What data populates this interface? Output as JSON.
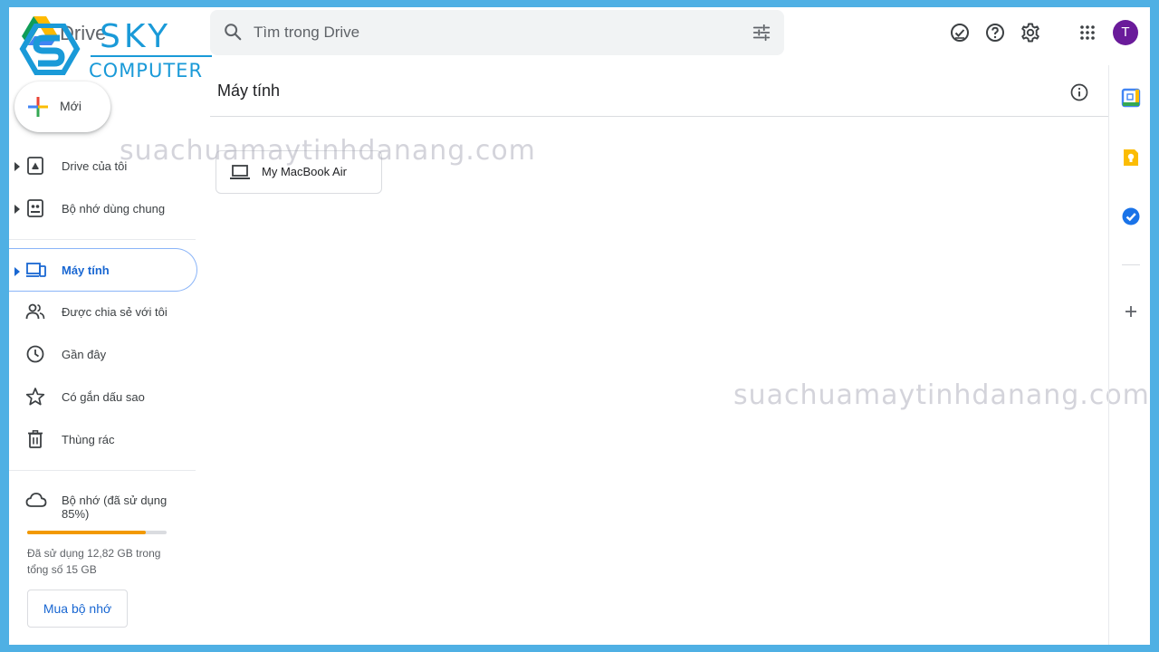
{
  "header": {
    "app_name": "Drive",
    "watermark_logo_line1": "SKY",
    "watermark_logo_line2": "COMPUTER",
    "search_placeholder": "Tìm trong Drive",
    "avatar_initial": "T"
  },
  "new_button": {
    "label": "Mới"
  },
  "nav": {
    "my_drive": "Drive của tôi",
    "shared_drives": "Bộ nhớ dùng chung",
    "computers": "Máy tính",
    "shared_with_me": "Được chia sẻ với tôi",
    "recent": "Gần đây",
    "starred": "Có gắn dấu sao",
    "trash": "Thùng rác",
    "storage": "Bộ nhớ (đã sử dụng 85%)"
  },
  "storage": {
    "used_fraction": 0.85,
    "usage_text": "Đã sử dụng 12,82 GB trong tổng số 15 GB",
    "buy_label": "Mua bộ nhớ"
  },
  "main": {
    "title": "Máy tính",
    "items": [
      {
        "label": "My MacBook Air"
      }
    ]
  },
  "watermark": {
    "text": "suachuamaytinhdanang.com"
  },
  "colors": {
    "accent": "#1967d2",
    "active_border": "#8ab4f8",
    "storage_fill": "#f29900",
    "avatar": "#6a1b9a",
    "frame": "#4fb0e4",
    "brand_logo": "#1a9ad8"
  },
  "icons": {
    "search": "search-icon",
    "filter": "tune-icon",
    "offline": "offline-check-icon",
    "help": "help-icon",
    "settings": "gear-icon",
    "apps": "apps-grid-icon",
    "info": "info-icon"
  }
}
